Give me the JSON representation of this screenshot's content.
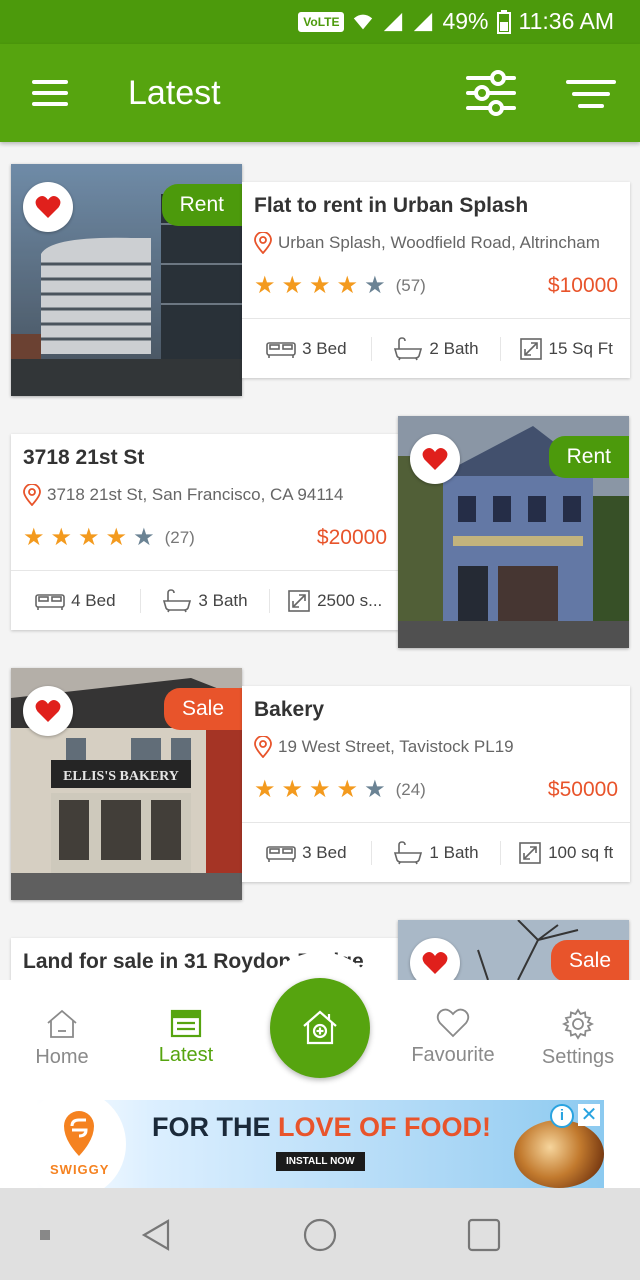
{
  "status_bar": {
    "volte": "VoLTE",
    "battery": "49%",
    "time": "11:36 AM"
  },
  "app_bar": {
    "title": "Latest"
  },
  "listings": [
    {
      "title": "Flat to rent in Urban Splash",
      "address": "Urban Splash, Woodfield Road, Altrincham",
      "tag": "Rent",
      "rating": 4,
      "reviews": "(57)",
      "price": "$10000",
      "bed": "3 Bed",
      "bath": "2 Bath",
      "area": "15 Sq Ft"
    },
    {
      "title": "3718 21st St",
      "address": "3718 21st St, San Francisco, CA 94114",
      "tag": "Rent",
      "rating": 4,
      "reviews": "(27)",
      "price": "$20000",
      "bed": "4 Bed",
      "bath": "3 Bath",
      "area": "2500 s..."
    },
    {
      "title": "Bakery",
      "address": "19 West Street, Tavistock PL19",
      "tag": "Sale",
      "rating": 4,
      "reviews": "(24)",
      "price": "$50000",
      "bed": "3 Bed",
      "bath": "1 Bath",
      "area": "100 sq ft"
    },
    {
      "title": "Land for sale in 31 Roydon Bridge",
      "tag": "Sale"
    }
  ],
  "bottom_nav": {
    "home": "Home",
    "latest": "Latest",
    "favourite": "Favourite",
    "settings": "Settings"
  },
  "ad": {
    "brand": "SWIGGY",
    "headline_1": "FOR THE ",
    "headline_2": "LOVE OF FOOD!",
    "cta": "INSTALL NOW"
  },
  "colors": {
    "primary": "#56a40f",
    "rent_tag": "#4c9a0c",
    "sale_tag": "#e8542b",
    "price": "#e8542b",
    "star": "#f39a1e"
  }
}
